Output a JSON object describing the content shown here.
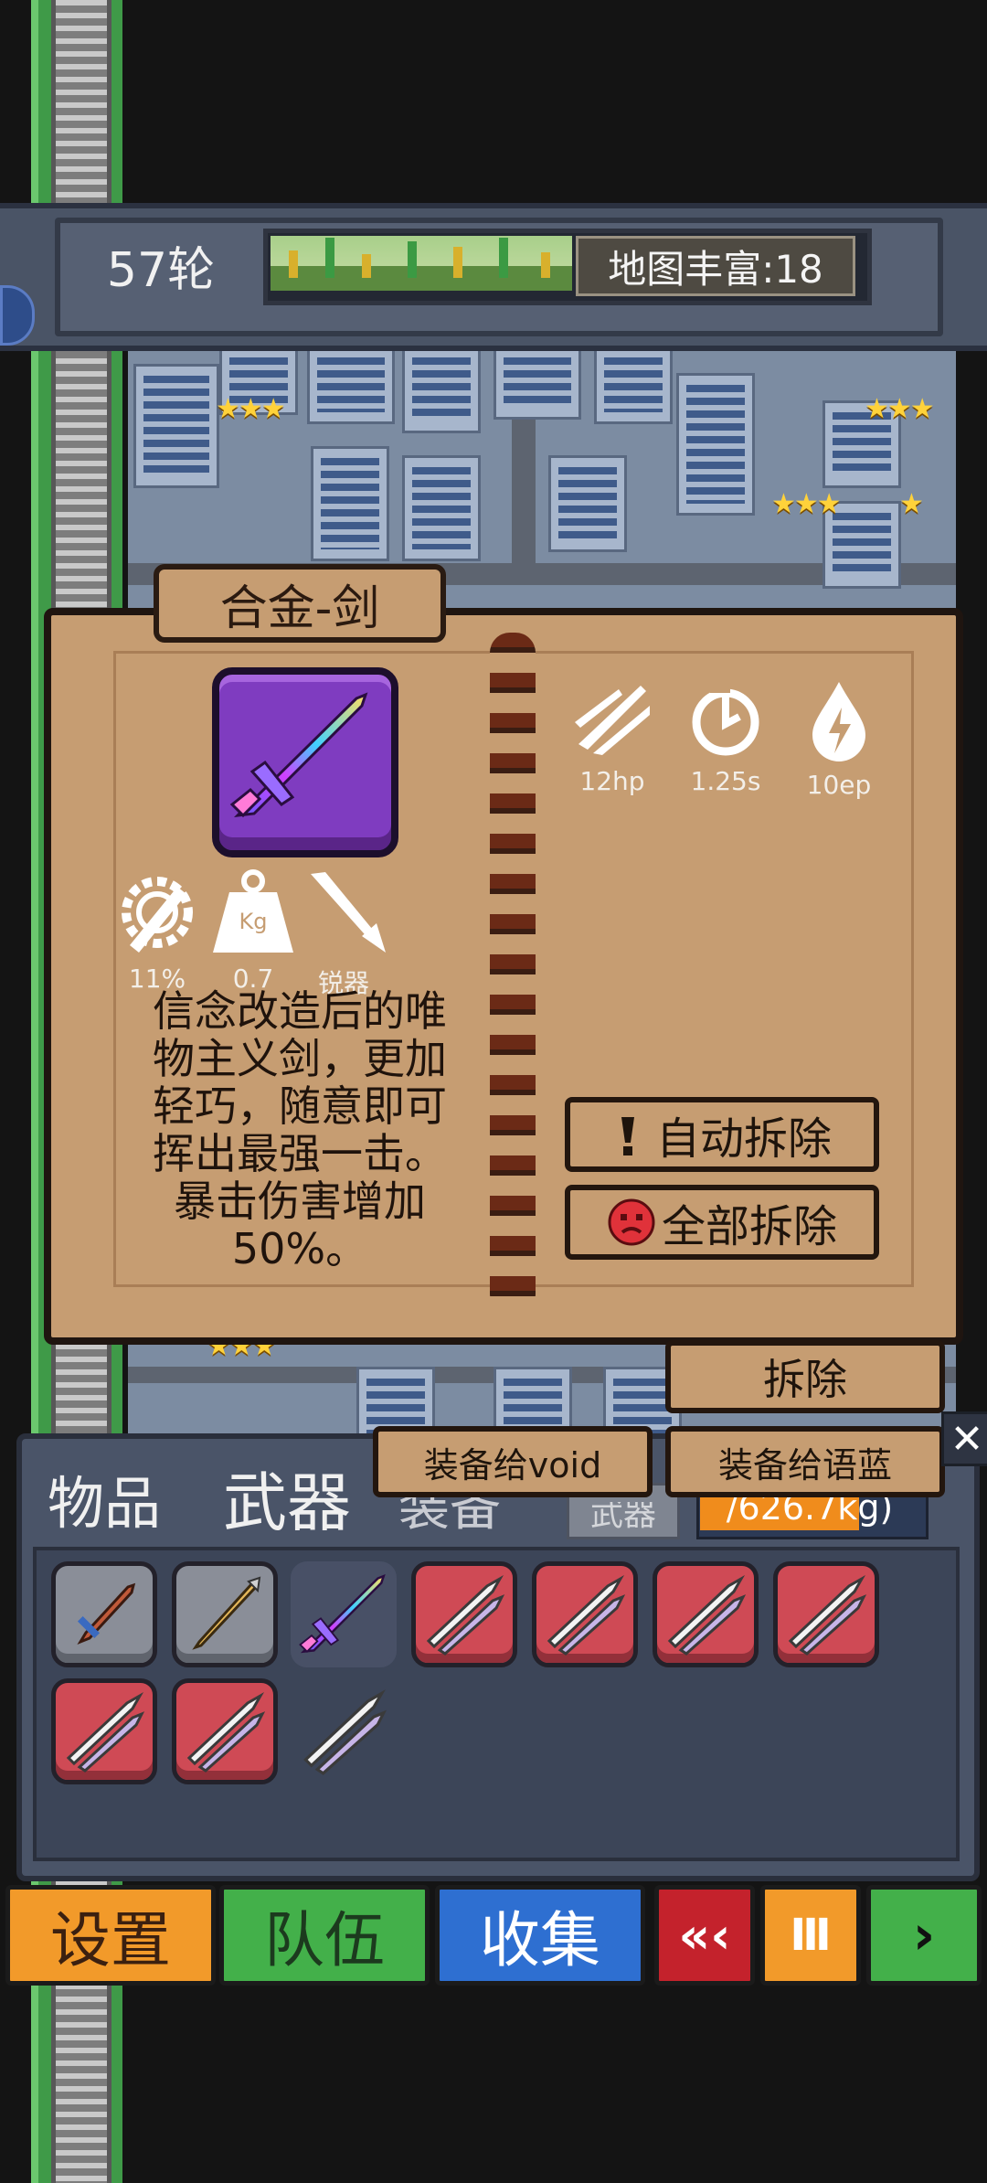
{
  "hud": {
    "round_label": "57轮",
    "map_richness_label": "地图丰富:18"
  },
  "item_panel": {
    "title": "合金-剑",
    "stats": [
      {
        "icon": "slash-damage-icon",
        "value": "12hp"
      },
      {
        "icon": "cooldown-icon",
        "value": "1.25s"
      },
      {
        "icon": "energy-drop-icon",
        "value": "10ep"
      }
    ],
    "attributes": [
      {
        "icon": "gear-wrench-icon",
        "value": "11%"
      },
      {
        "icon": "weight-kg-icon",
        "value": "0.7",
        "icon_text": "Kg"
      },
      {
        "icon": "sharp-blade-icon",
        "value": "锐器"
      }
    ],
    "description": "信念改造后的唯物主义剑，更加轻巧，随意即可挥出最强一击。暴击伤害增加50%。",
    "description_lines": [
      "信念改造后的唯",
      "物主义剑，更加",
      "轻巧，随意即可",
      "挥出最强一击。",
      "暴击伤害增加",
      "50%。"
    ],
    "auto_dismantle_label": "自动拆除",
    "dismantle_all_label": "全部拆除"
  },
  "action_popup": {
    "dismantle_label": "拆除",
    "equip_void_label": "装备给void",
    "equip_yulan_label": "装备给语蓝"
  },
  "inventory": {
    "tabs": [
      {
        "label": "物品"
      },
      {
        "label": "武器"
      },
      {
        "label": "装备"
      }
    ],
    "filter_label": "武器",
    "weight_text": "/626.7kg)",
    "slots": [
      {
        "type": "wooden-sword-icon",
        "frame": "gray"
      },
      {
        "type": "spear-icon",
        "frame": "gray"
      },
      {
        "type": "alloy-sword-icon",
        "frame": "none"
      },
      {
        "type": "double-blade-icon",
        "frame": "red"
      },
      {
        "type": "double-blade-icon",
        "frame": "red"
      },
      {
        "type": "double-blade-icon",
        "frame": "red"
      },
      {
        "type": "double-blade-icon",
        "frame": "red"
      },
      {
        "type": "double-blade-icon",
        "frame": "red"
      },
      {
        "type": "double-blade-icon",
        "frame": "red"
      },
      {
        "type": "double-blade-icon",
        "frame": "none"
      }
    ]
  },
  "bottom_bar": {
    "settings_label": "设置",
    "team_label": "队伍",
    "collection_label": "收集",
    "rewind_label": "«‹",
    "pause_label": "Ⅲ",
    "play_label": "›"
  },
  "colors": {
    "settings": "#f29a2a",
    "team": "#43b04a",
    "collection": "#2e6fd1",
    "rewind": "#c4222c",
    "pause": "#f29a2a",
    "play": "#43b04a"
  }
}
